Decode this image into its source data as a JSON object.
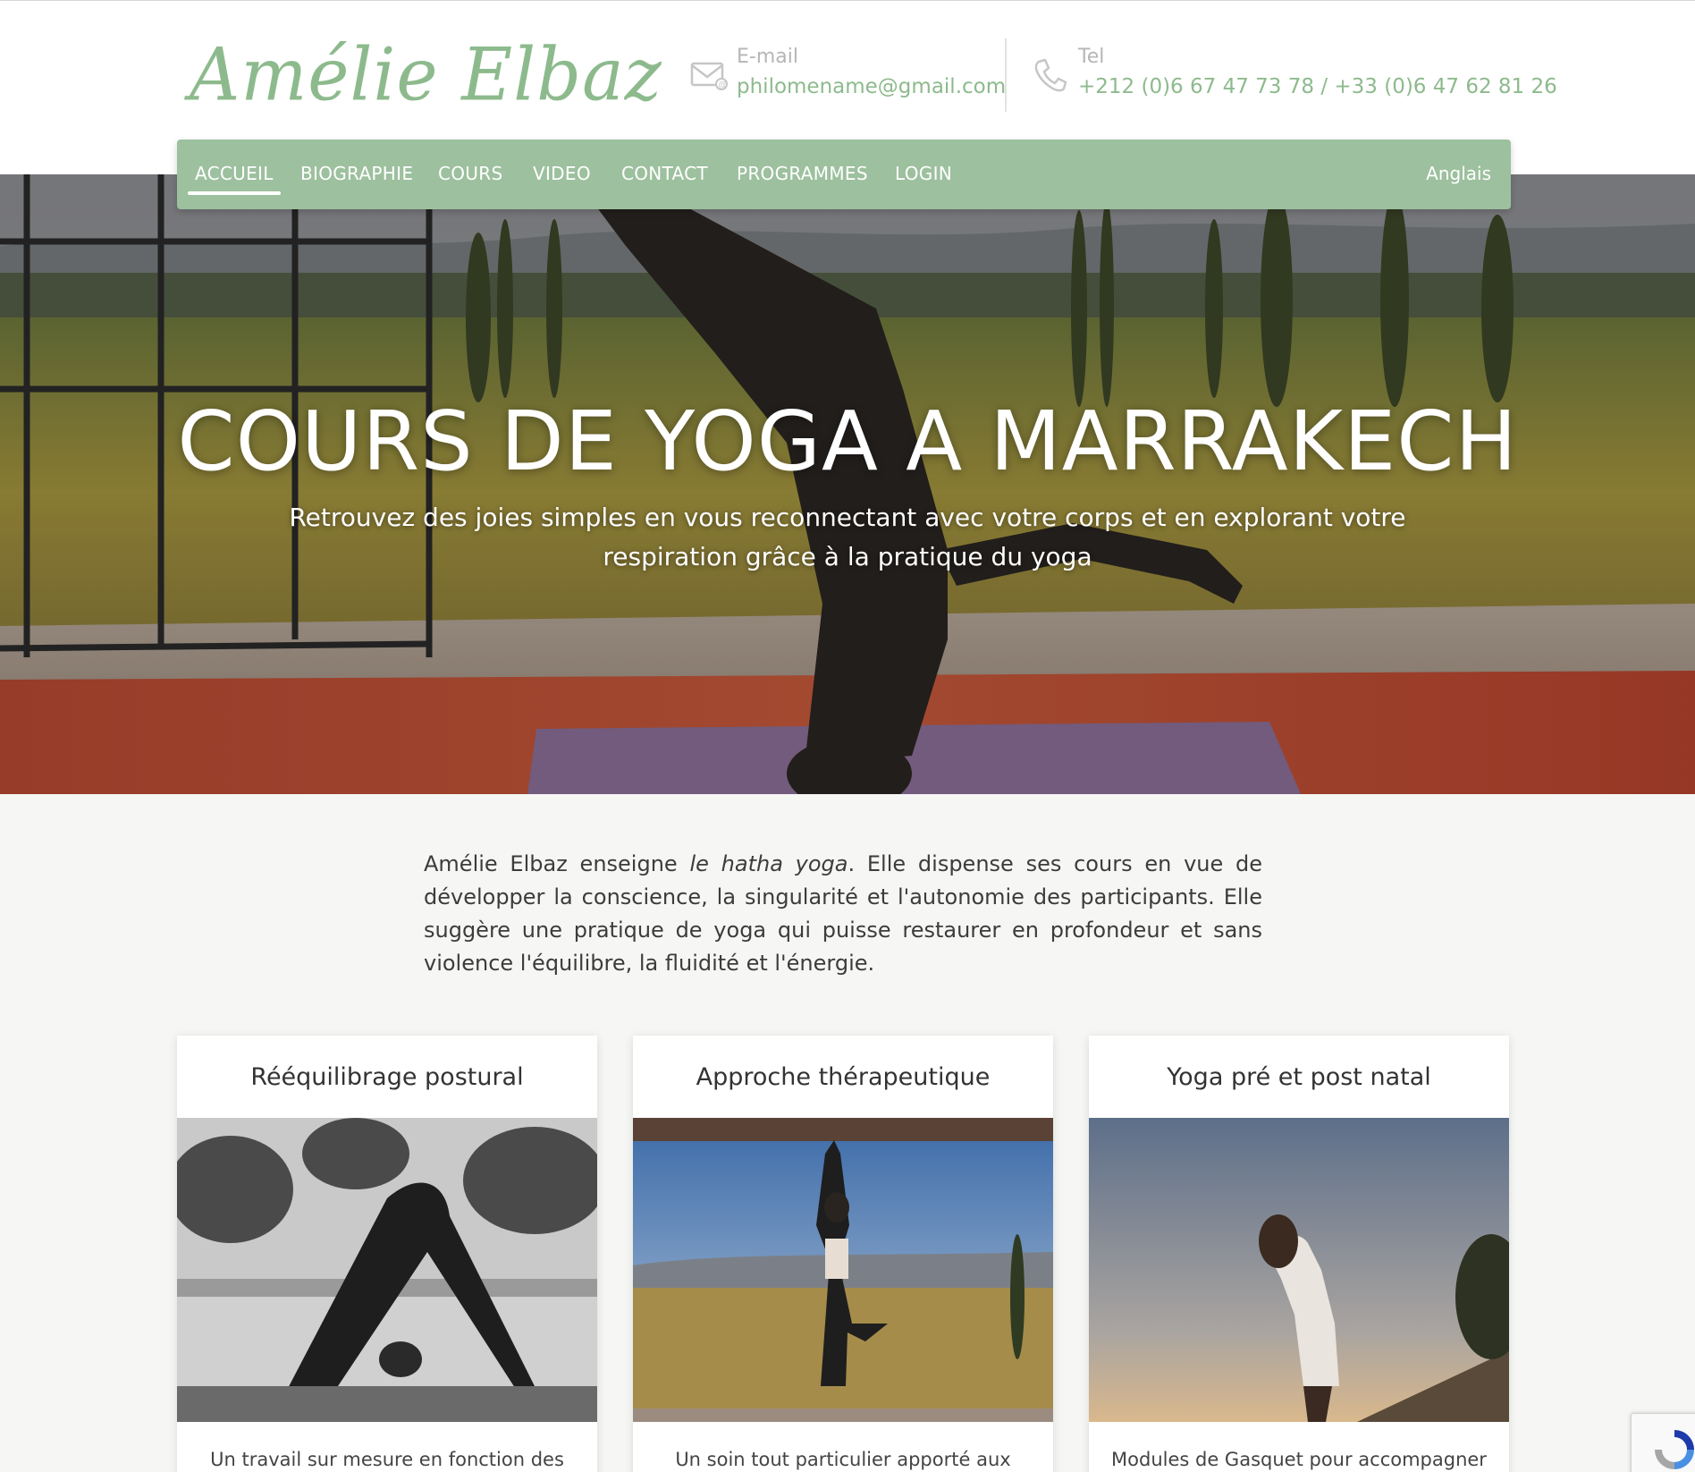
{
  "header": {
    "logo": "Amélie Elbaz",
    "email_label": "E-mail",
    "email_value": "philomename@gmail.com",
    "tel_label": "Tel",
    "tel_value": "+212 (0)6 67 47 73 78 / +33 (0)6 47 62 81 26",
    "email_icon": "envelope-icon",
    "tel_icon": "phone-icon"
  },
  "nav": {
    "items": [
      "ACCUEIL",
      "BIOGRAPHIE",
      "COURS",
      "VIDEO",
      "CONTACT",
      "PROGRAMMES",
      "LOGIN"
    ],
    "active": "ACCUEIL",
    "language": "Anglais"
  },
  "hero": {
    "title": "COURS DE YOGA A MARRAKECH",
    "subtitle": "Retrouvez des joies simples en vous reconnectant avec votre corps et en explorant votre respiration grâce à la pratique du yoga"
  },
  "intro": {
    "before_em": "Amélie Elbaz enseigne ",
    "em": "le hatha yoga",
    "after_em": ". Elle dispense ses cours en vue de développer la conscience, la singularité et l'autonomie des participants. Elle suggère une pratique de yoga qui puisse restaurer en profondeur et sans violence l'équilibre, la fluidité et l'énergie."
  },
  "cards": [
    {
      "title": "Rééquilibrage postural",
      "text": "Un travail sur mesure en fonction des"
    },
    {
      "title": "Approche thérapeutique",
      "text": "Un soin tout particulier apporté aux"
    },
    {
      "title": "Yoga pré et post natal",
      "text": "Modules de Gasquet pour accompagner la"
    }
  ],
  "colors": {
    "brand_green": "#9dc09e",
    "logo_green": "#8dba8d"
  }
}
